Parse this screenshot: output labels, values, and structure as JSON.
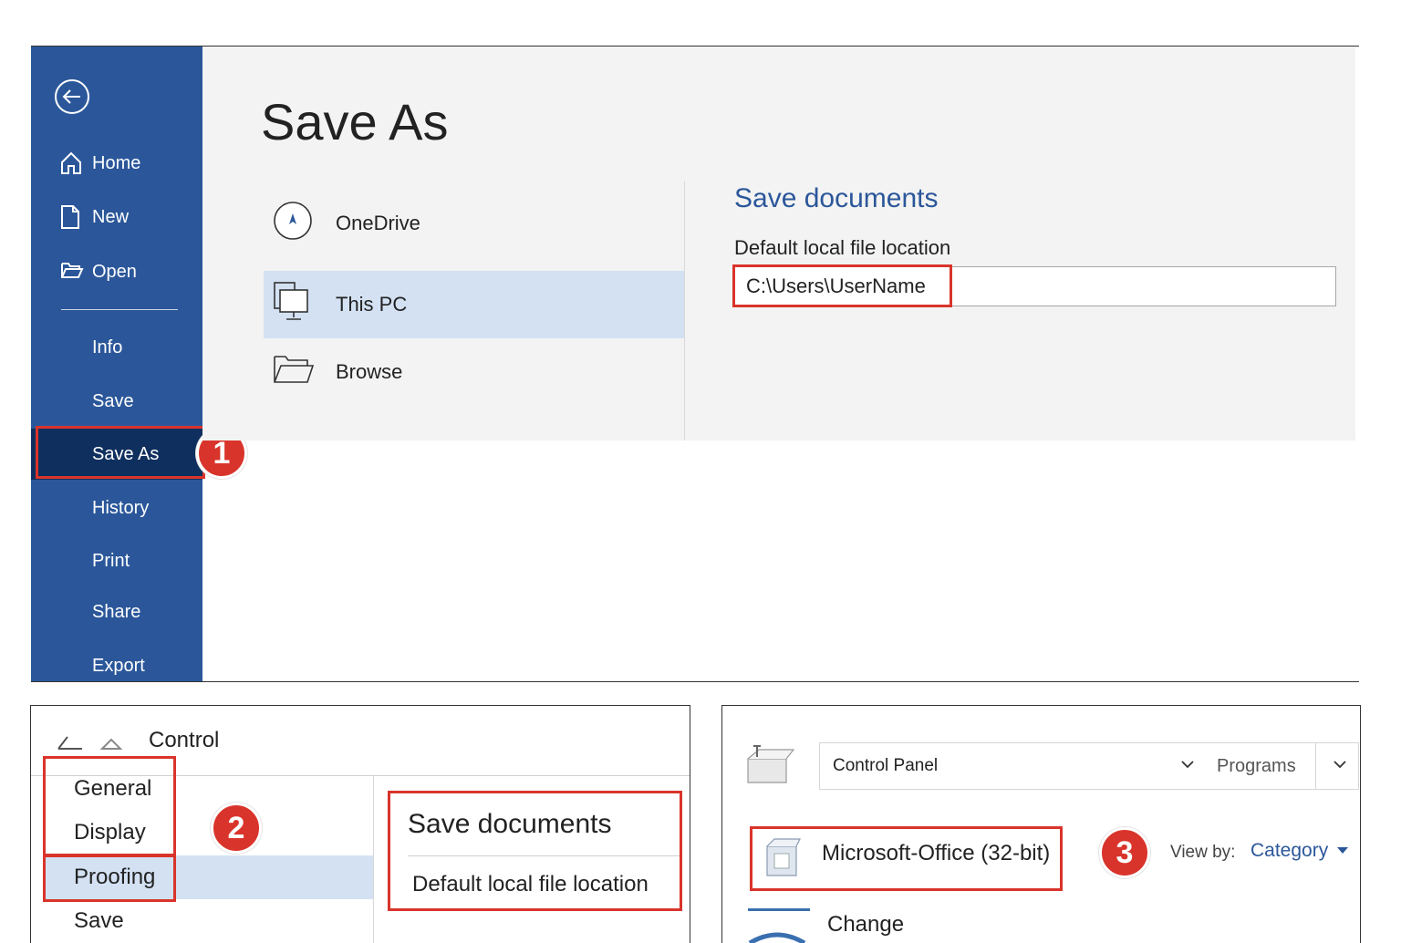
{
  "save_as_panel": {
    "sidebar": {
      "back_icon": "back-arrow-icon",
      "items": [
        {
          "label": "Home",
          "icon": "home-icon"
        },
        {
          "label": "New",
          "icon": "new-document-icon"
        },
        {
          "label": "Open",
          "icon": "open-folder-icon"
        },
        {
          "label": "Info"
        },
        {
          "label": "Save"
        },
        {
          "label": "Save As",
          "selected": true
        },
        {
          "label": "History"
        },
        {
          "label": "Print"
        },
        {
          "label": "Share"
        },
        {
          "label": "Export"
        }
      ]
    },
    "title": "Save As",
    "places": [
      {
        "label": "OneDrive",
        "icon": "onedrive-icon"
      },
      {
        "label": "This PC",
        "icon": "computer-icon",
        "selected": true
      },
      {
        "label": "Browse",
        "icon": "folder-icon"
      }
    ],
    "save_documents": {
      "title": "Save documents",
      "field_label": "Default local file location",
      "field_value": "C:\\Users\\UserName"
    }
  },
  "options_panel": {
    "title": "Control",
    "categories": [
      {
        "label": "General"
      },
      {
        "label": "Display"
      },
      {
        "label": "Proofing",
        "selected": true
      },
      {
        "label": "Save"
      }
    ],
    "right_title": "Save documents",
    "right_label": "Default local file location"
  },
  "control_panel": {
    "address": "Control Panel",
    "programs": "Programs",
    "program_item": "Microsoft-Office (32-bit)",
    "view_by_label": "View by:",
    "view_by_value": "Category",
    "change_label": "Change"
  },
  "steps": [
    "1",
    "2",
    "3"
  ],
  "colors": {
    "sidebar_blue": "#2b579a",
    "selected_nav": "#0f2f5f",
    "selection_highlight": "#d3e1f3",
    "highlight_red": "#d9342b",
    "heading_blue": "#2b579a"
  }
}
